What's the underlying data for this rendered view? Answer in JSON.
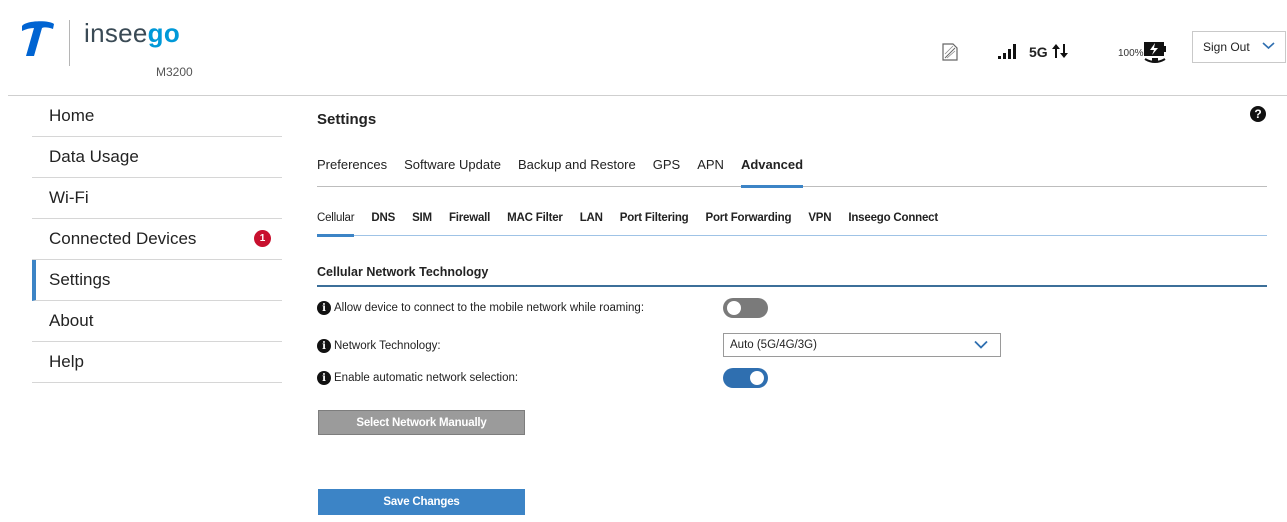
{
  "header": {
    "brand_prefix": "insee",
    "brand_suffix": "go",
    "model": "M3200",
    "network_type": "5G",
    "battery_percent": "100%",
    "sign_out_label": "Sign Out"
  },
  "sidebar": {
    "items": [
      {
        "label": "Home"
      },
      {
        "label": "Data Usage"
      },
      {
        "label": "Wi-Fi"
      },
      {
        "label": "Connected Devices",
        "badge": "1"
      },
      {
        "label": "Settings",
        "active": true
      },
      {
        "label": "About"
      },
      {
        "label": "Help"
      }
    ]
  },
  "main": {
    "title": "Settings",
    "help_glyph": "?",
    "tabs": [
      {
        "label": "Preferences"
      },
      {
        "label": "Software Update"
      },
      {
        "label": "Backup and Restore"
      },
      {
        "label": "GPS"
      },
      {
        "label": "APN"
      },
      {
        "label": "Advanced",
        "active": true
      }
    ],
    "subtabs": [
      {
        "label": "Cellular",
        "active": true
      },
      {
        "label": "DNS"
      },
      {
        "label": "SIM"
      },
      {
        "label": "Firewall"
      },
      {
        "label": "MAC Filter"
      },
      {
        "label": "LAN"
      },
      {
        "label": "Port Filtering"
      },
      {
        "label": "Port Forwarding"
      },
      {
        "label": "VPN"
      },
      {
        "label": "Inseego Connect"
      }
    ],
    "section_title": "Cellular Network Technology",
    "roaming": {
      "label": "Allow device to connect to the mobile network while roaming:",
      "enabled": false
    },
    "network_technology": {
      "label": "Network Technology:",
      "value": "Auto (5G/4G/3G)"
    },
    "auto_selection": {
      "label": "Enable automatic network selection:",
      "enabled": true
    },
    "select_manual_label": "Select Network Manually",
    "save_label": "Save Changes"
  },
  "colors": {
    "accent": "#3c84c6",
    "brand_blue": "#0099d8",
    "badge_red": "#c8102e",
    "toggle_on": "#2f6fb0",
    "button_disabled": "#9b9b9b"
  },
  "icons": {
    "logo": "telstra-t-icon",
    "sim": "sim-card-icon",
    "signal": "signal-bars-icon",
    "data_activity": "up-down-arrows-icon",
    "battery": "battery-charging-icon",
    "info": "info-icon",
    "help": "question-icon"
  }
}
